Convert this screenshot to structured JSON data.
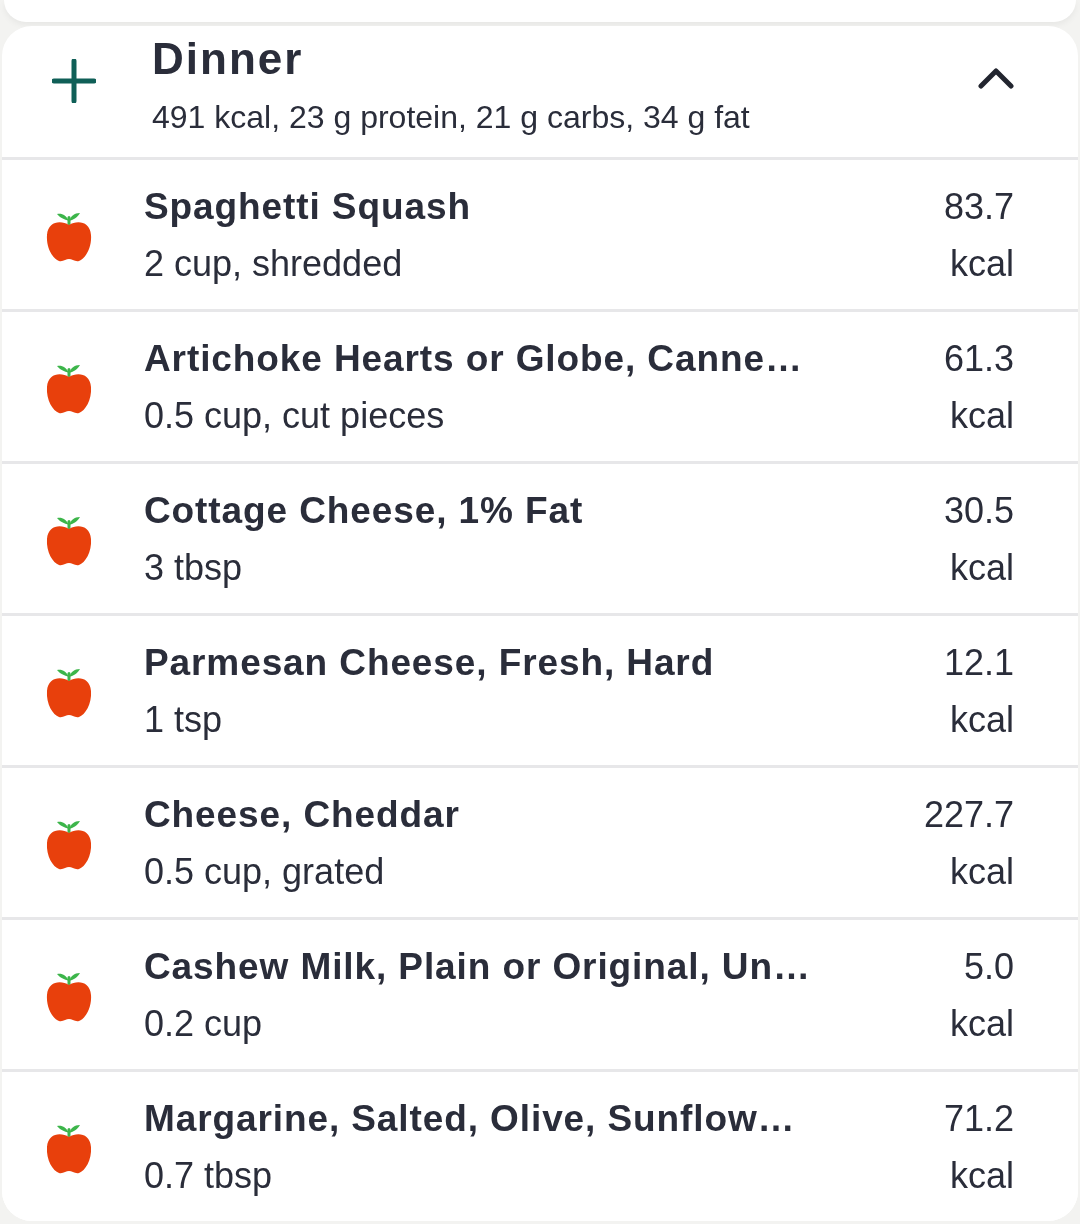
{
  "meal": {
    "title": "Dinner",
    "summary": "491 kcal, 23 g protein, 21 g carbs, 34 g fat",
    "expanded": true
  },
  "foods": [
    {
      "name": "Spaghetti Squash",
      "portion": "2 cup, shredded",
      "calories": "83.7",
      "unit": "kcal"
    },
    {
      "name": "Artichoke Hearts or Globe, Canne…",
      "portion": "0.5 cup, cut pieces",
      "calories": "61.3",
      "unit": "kcal"
    },
    {
      "name": "Cottage Cheese, 1% Fat",
      "portion": "3 tbsp",
      "calories": "30.5",
      "unit": "kcal"
    },
    {
      "name": "Parmesan Cheese, Fresh, Hard",
      "portion": "1 tsp",
      "calories": "12.1",
      "unit": "kcal"
    },
    {
      "name": "Cheese, Cheddar",
      "portion": "0.5 cup, grated",
      "calories": "227.7",
      "unit": "kcal"
    },
    {
      "name": "Cashew Milk, Plain or Original, Un…",
      "portion": "0.2 cup",
      "calories": "5.0",
      "unit": "kcal"
    },
    {
      "name": "Margarine, Salted, Olive, Sunflow…",
      "portion": "0.7 tbsp",
      "calories": "71.2",
      "unit": "kcal"
    }
  ]
}
